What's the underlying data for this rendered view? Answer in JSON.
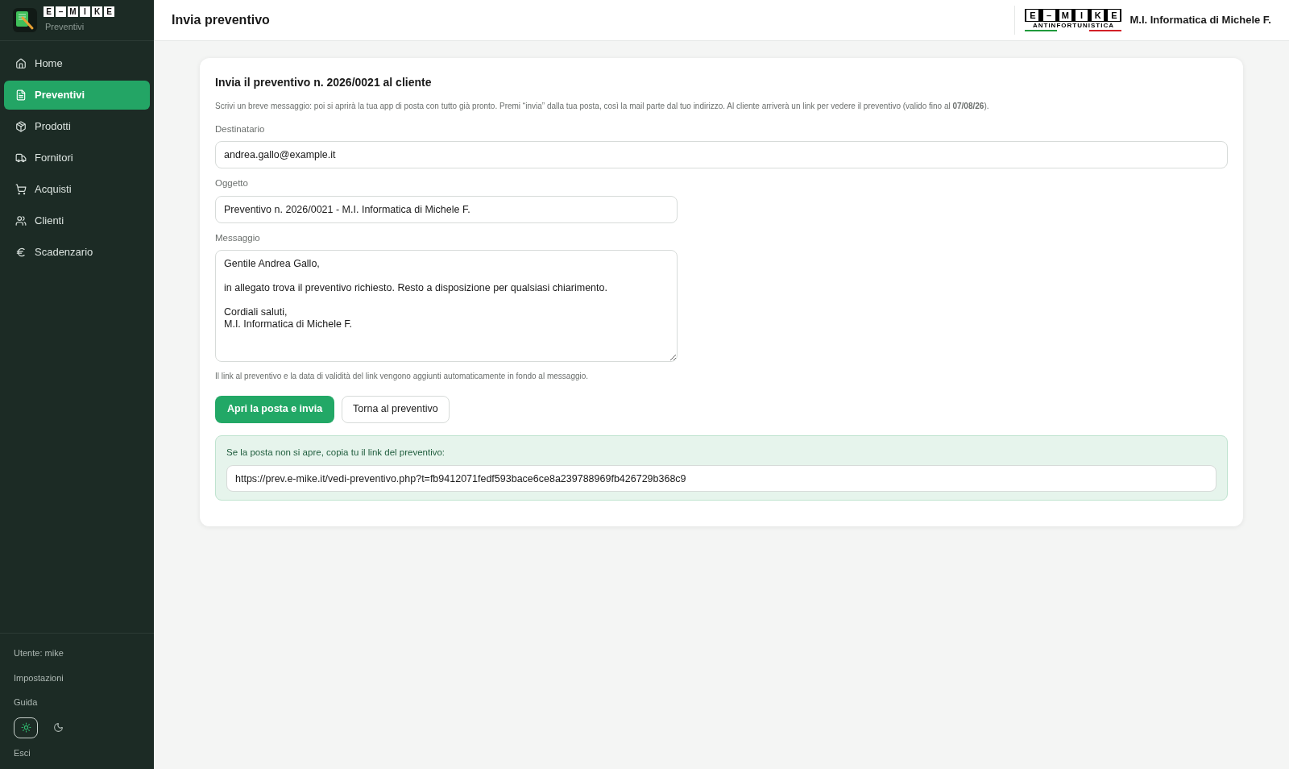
{
  "sidebar": {
    "logo_letters": [
      "E",
      "–",
      "M",
      "I",
      "K",
      "E"
    ],
    "app_name": "Preventivi",
    "items": [
      {
        "label": "Home",
        "selected": false
      },
      {
        "label": "Preventivi",
        "selected": true
      },
      {
        "label": "Prodotti",
        "selected": false
      },
      {
        "label": "Fornitori",
        "selected": false
      },
      {
        "label": "Acquisti",
        "selected": false
      },
      {
        "label": "Clienti",
        "selected": false
      },
      {
        "label": "Scadenzario",
        "selected": false
      }
    ],
    "user": "Utente: mike",
    "links": [
      "Impostazioni",
      "Guida"
    ],
    "theme": [
      {
        "kind": "light",
        "selected": true
      },
      {
        "kind": "dark",
        "selected": false
      }
    ],
    "logout": "Esci"
  },
  "header": {
    "title": "Invia preventivo",
    "logo_letters": [
      "E",
      "–",
      "M",
      "I",
      "K",
      "E"
    ],
    "logo_tagline": "ANTINFORTUNISTICA",
    "company": "M.I. Informatica di Michele F."
  },
  "card": {
    "title": "Invia il preventivo n. 2026/0021 al cliente",
    "intro": "Scrivi un breve messaggio: poi si aprirà la tua app di posta con tutto già pronto. Premi “invia” dalla tua posta, così la mail parte dal tuo indirizzo. Al cliente arriverà un link per vedere il preventivo (valido fino al **07/08/26**).",
    "recipient": {
      "label": "Destinatario",
      "value": "andrea.gallo@example.it"
    },
    "subject": {
      "label": "Oggetto",
      "value": "Preventivo n. 2026/0021 - M.I. Informatica di Michele F."
    },
    "message": {
      "label": "Messaggio",
      "value": "Gentile Andrea Gallo,\n\nin allegato trova il preventivo richiesto. Resto a disposizione per qualsiasi chiarimento.\n\nCordiali saluti,\nM.I. Informatica di Michele F."
    },
    "note": "Il link al preventivo e la data di validità del link vengono aggiunti automaticamente in fondo al messaggio.",
    "primary_button": "Apri la posta e invia",
    "secondary_button": "Torna al preventivo",
    "fallback": {
      "text": "Se la posta non si apre, copia tu il link del preventivo:",
      "link": "https://prev.e-mike.it/vedi-preventivo.php?t=fb9412071fedf593bace6ce8a239788969fb426729b368c9"
    }
  }
}
